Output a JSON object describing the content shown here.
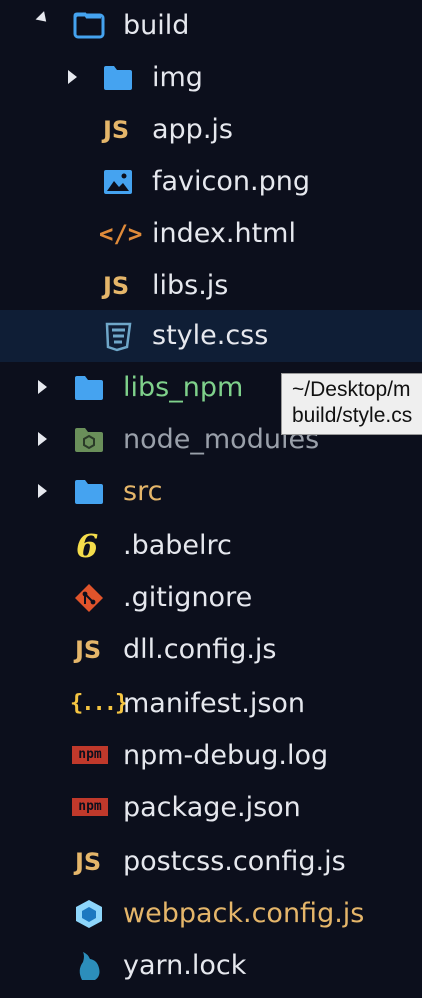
{
  "tree": {
    "items": [
      {
        "label": "build",
        "icon": "folder-open-icon",
        "expanded": true
      },
      {
        "label": "img",
        "icon": "folder-icon",
        "expanded": false
      },
      {
        "label": "app.js",
        "icon": "javascript-file-icon",
        "icon_text": "JS"
      },
      {
        "label": "favicon.png",
        "icon": "image-file-icon"
      },
      {
        "label": "index.html",
        "icon": "html-file-icon",
        "icon_text": "</>"
      },
      {
        "label": "libs.js",
        "icon": "javascript-file-icon",
        "icon_text": "JS"
      },
      {
        "label": "style.css",
        "icon": "css-file-icon",
        "selected": true
      },
      {
        "label": "libs_npm",
        "icon": "folder-icon",
        "expanded": false,
        "color": "#7fd18b"
      },
      {
        "label": "node_modules",
        "icon": "node-folder-icon",
        "expanded": false,
        "color": "#9aa0aa"
      },
      {
        "label": "src",
        "icon": "folder-icon",
        "expanded": false,
        "color": "#e5b66a"
      },
      {
        "label": ".babelrc",
        "icon": "babel-icon",
        "icon_text": "6"
      },
      {
        "label": ".gitignore",
        "icon": "git-icon"
      },
      {
        "label": "dll.config.js",
        "icon": "javascript-file-icon",
        "icon_text": "JS"
      },
      {
        "label": "manifest.json",
        "icon": "json-file-icon",
        "icon_text": "{...}"
      },
      {
        "label": "npm-debug.log",
        "icon": "npm-icon",
        "icon_text": "npm"
      },
      {
        "label": "package.json",
        "icon": "npm-icon",
        "icon_text": "npm"
      },
      {
        "label": "postcss.config.js",
        "icon": "javascript-file-icon",
        "icon_text": "JS"
      },
      {
        "label": "webpack.config.js",
        "icon": "webpack-icon",
        "color": "#e5b66a"
      },
      {
        "label": "yarn.lock",
        "icon": "yarn-icon"
      }
    ]
  },
  "tooltip": {
    "line1": "~/Desktop/m",
    "line2": "build/style.cs"
  },
  "colors": {
    "background": "#0c0f1c",
    "selected_row": "#0f1e36",
    "folder_blue": "#45a3f0",
    "js_yellow": "#e5b66a",
    "green_label": "#7fd18b",
    "orange_label": "#e5b66a",
    "npm_red": "#c0392b"
  }
}
